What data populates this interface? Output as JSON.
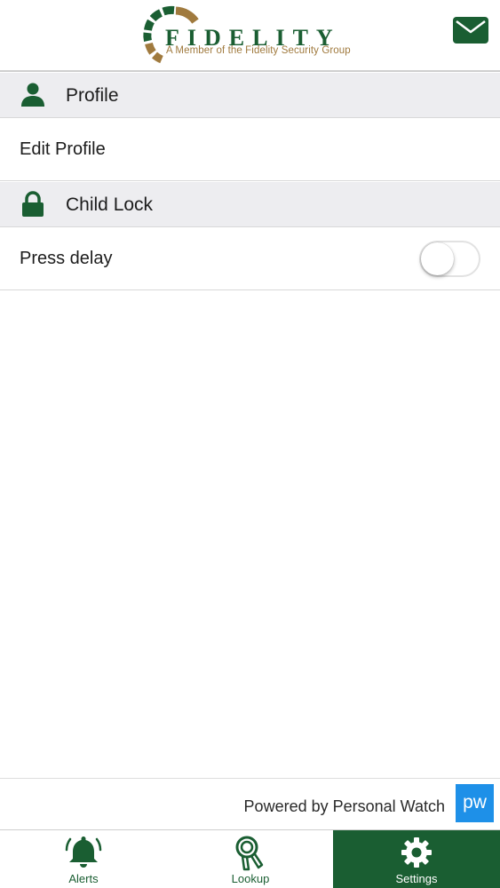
{
  "header": {
    "logo_word": "FIDELITY",
    "logo_tagline": "A Member of the Fidelity Security Group",
    "mail_icon": "envelope-icon"
  },
  "sections": [
    {
      "title": "Profile",
      "icon": "person-icon"
    },
    {
      "title": "Child Lock",
      "icon": "lock-icon"
    }
  ],
  "rows": {
    "edit_profile": "Edit Profile",
    "press_delay": "Press delay",
    "press_delay_enabled": false
  },
  "footer": {
    "powered_text": "Powered by Personal Watch",
    "badge": "pw"
  },
  "tabs": [
    {
      "label": "Alerts",
      "icon": "bell-icon",
      "active": false
    },
    {
      "label": "Lookup",
      "icon": "lookup-icon",
      "active": false
    },
    {
      "label": "Settings",
      "icon": "gear-icon",
      "active": true
    }
  ],
  "colors": {
    "brand_green": "#1a5e32",
    "brand_gold": "#a07a3e",
    "badge_blue": "#1e90e8"
  }
}
